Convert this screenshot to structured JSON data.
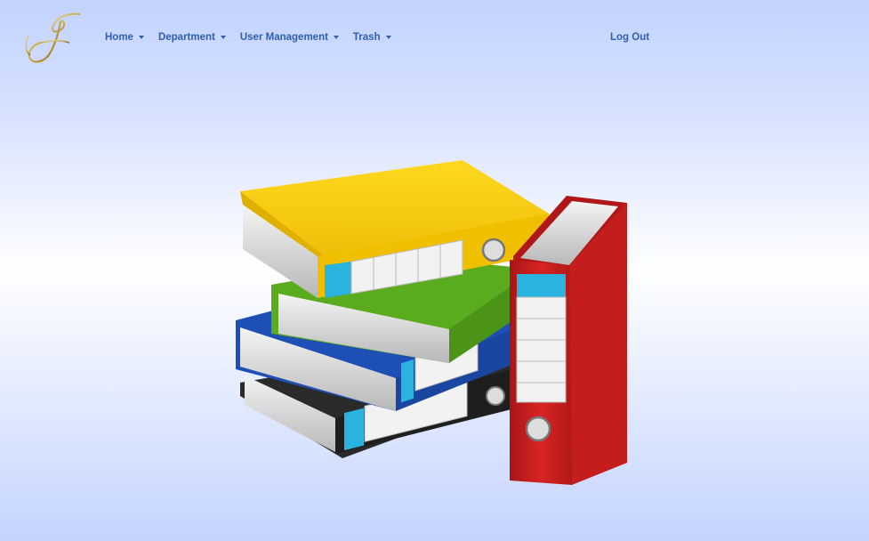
{
  "brand": {
    "logo_icon": "script-j-monogram-icon"
  },
  "nav": {
    "items": [
      {
        "label": "Home",
        "icon": "caret-down-icon"
      },
      {
        "label": "Department",
        "icon": "caret-down-icon"
      },
      {
        "label": "User Management",
        "icon": "caret-down-icon"
      },
      {
        "label": "Trash",
        "icon": "caret-down-icon"
      }
    ],
    "logout_label": "Log Out"
  },
  "hero": {
    "illustration": "binders-stack-icon"
  },
  "colors": {
    "link": "#2f5fb0",
    "background_top": "#c3d3ff",
    "background_mid": "#ffffff",
    "binder_yellow": "#f2c400",
    "binder_green": "#5aab1e",
    "binder_blue": "#1e4fb5",
    "binder_black": "#2a2a2a",
    "binder_red": "#cc1f1f",
    "label_cyan": "#2bb3e0",
    "logo_gold": "#c9a646"
  }
}
